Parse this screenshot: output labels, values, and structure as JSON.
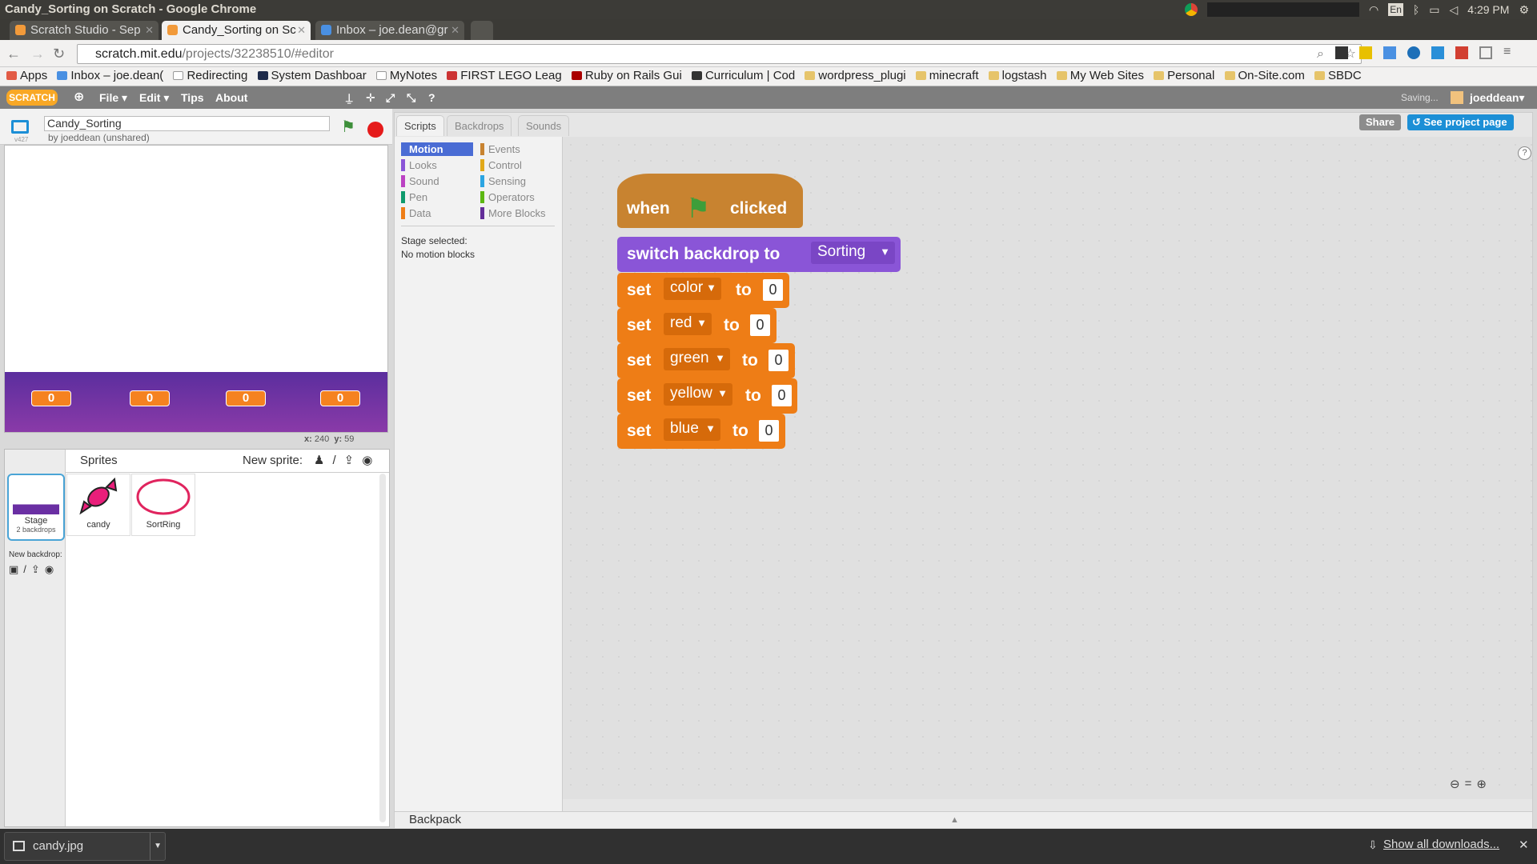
{
  "window_title": "Candy_Sorting on Scratch - Google Chrome",
  "system": {
    "time": "4:29 PM",
    "lang": "En"
  },
  "tabs": [
    {
      "label": "Scratch Studio - Sep"
    },
    {
      "label": "Candy_Sorting on Sc"
    },
    {
      "label": "Inbox – joe.dean@gr"
    }
  ],
  "url": {
    "host": "scratch.mit.edu",
    "path": "/projects/32238510/#editor"
  },
  "bookmarks": [
    "Apps",
    "Inbox – joe.dean(",
    "Redirecting",
    "System Dashboar",
    "MyNotes",
    "FIRST LEGO Leag",
    "Ruby on Rails Gui",
    "Curriculum | Cod",
    "wordpress_plugi",
    "minecraft",
    "logstash",
    "My Web Sites",
    "Personal",
    "On-Site.com",
    "SBDC"
  ],
  "scratch_menu": {
    "logo": "SCRATCH",
    "file": "File",
    "edit": "Edit",
    "tips": "Tips",
    "about": "About",
    "saving": "Saving...",
    "user": "joeddean"
  },
  "project": {
    "title": "Candy_Sorting",
    "byline": "by joeddean (unshared)",
    "version": "v427"
  },
  "stage": {
    "counters": [
      "0",
      "0",
      "0",
      "0"
    ],
    "x_label": "x:",
    "x_val": "240",
    "y_label": "y:",
    "y_val": "59"
  },
  "sprites_panel": {
    "header": "Sprites",
    "new_sprite": "New sprite:",
    "stage_label": "Stage",
    "stage_sub": "2 backdrops",
    "new_backdrop": "New backdrop:",
    "sprites": [
      {
        "name": "candy"
      },
      {
        "name": "SortRing"
      }
    ]
  },
  "editor_tabs": {
    "scripts": "Scripts",
    "backdrops": "Backdrops",
    "sounds": "Sounds"
  },
  "buttons": {
    "share": "Share",
    "see_project": "See project page"
  },
  "categories": [
    {
      "name": "Motion",
      "color": "#4a6cd4"
    },
    {
      "name": "Looks",
      "color": "#8a55d7"
    },
    {
      "name": "Sound",
      "color": "#bb42c3"
    },
    {
      "name": "Pen",
      "color": "#0e9a6c"
    },
    {
      "name": "Data",
      "color": "#ee7d16"
    },
    {
      "name": "Events",
      "color": "#c88330"
    },
    {
      "name": "Control",
      "color": "#e1a91a"
    },
    {
      "name": "Sensing",
      "color": "#2ca5e2"
    },
    {
      "name": "Operators",
      "color": "#5cb712"
    },
    {
      "name": "More Blocks",
      "color": "#632d99"
    }
  ],
  "palette_note": {
    "line1": "Stage selected:",
    "line2": "No motion blocks"
  },
  "script": {
    "hat": {
      "when": "when",
      "clicked": "clicked"
    },
    "switch": {
      "text": "switch backdrop to",
      "value": "Sorting"
    },
    "sets": [
      {
        "kw": "set",
        "var": "color",
        "to": "to",
        "value": "0"
      },
      {
        "kw": "set",
        "var": "red",
        "to": "to",
        "value": "0"
      },
      {
        "kw": "set",
        "var": "green",
        "to": "to",
        "value": "0"
      },
      {
        "kw": "set",
        "var": "yellow",
        "to": "to",
        "value": "0"
      },
      {
        "kw": "set",
        "var": "blue",
        "to": "to",
        "value": "0"
      }
    ]
  },
  "backpack": "Backpack",
  "downloads": {
    "file": "candy.jpg",
    "show_all": "Show all downloads..."
  },
  "colors": {
    "events": "#c88330",
    "looks": "#8a55d7",
    "data": "#ee7d16",
    "accent": "#1c8fd6"
  }
}
